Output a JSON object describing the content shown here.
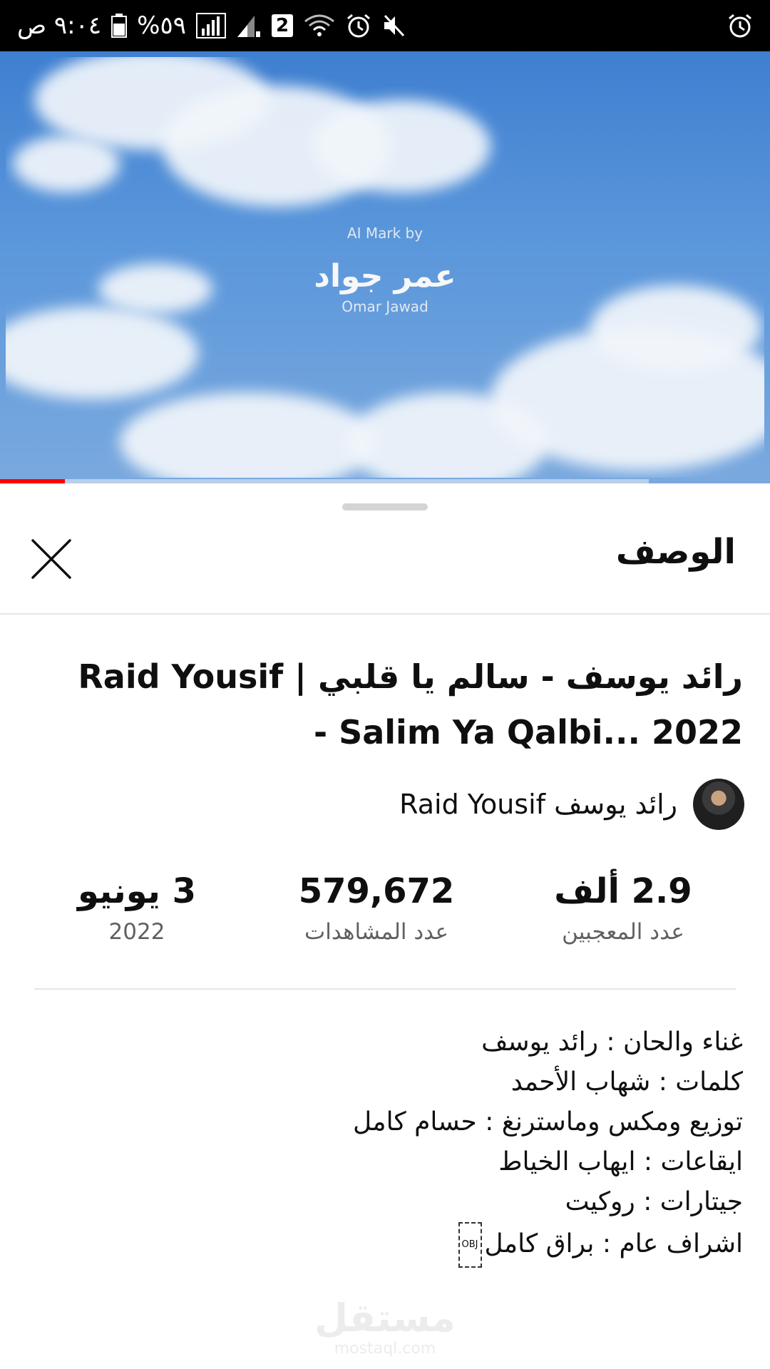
{
  "status_bar": {
    "time": "٩:٠٤ ص",
    "battery": "%٥٩",
    "sim_badge": "2",
    "icons": [
      "mute-icon",
      "alarm-icon",
      "wifi-icon",
      "signal-icon",
      "signal-icon",
      "battery-icon",
      "alarm-icon"
    ]
  },
  "video": {
    "overlay_top": "AI Mark by",
    "overlay_main": "عمر جواد",
    "overlay_latin": "Omar Jawad",
    "progress": 0.1
  },
  "sheet": {
    "title": "الوصف",
    "video_title": "رائد يوسف - سالم يا قلبي | Raid Yousif - Salim Ya Qalbi... 2022",
    "channel_name": "رائد يوسف Raid Yousif",
    "stats": {
      "likes_value": "2.9 ألف",
      "likes_label": "عدد المعجبين",
      "views_value": "579,672",
      "views_label": "عدد المشاهدات",
      "date_value": "3 يونيو",
      "date_year": "2022"
    },
    "description": [
      "غناء والحان : رائد يوسف",
      "كلمات : شهاب الأحمد",
      "توزيع ومكس وماسترنغ : حسام كامل",
      "ايقاعات : ايهاب الخياط",
      "جيتارات : روكيت",
      "اشراف عام : براق كامل"
    ],
    "object_marker": "OBJ"
  },
  "watermark": {
    "main": "مستقل",
    "sub": "mostaql.com"
  },
  "colors": {
    "progress": "#ff0000",
    "text_primary": "#0f0f0f",
    "text_secondary": "#606060"
  }
}
